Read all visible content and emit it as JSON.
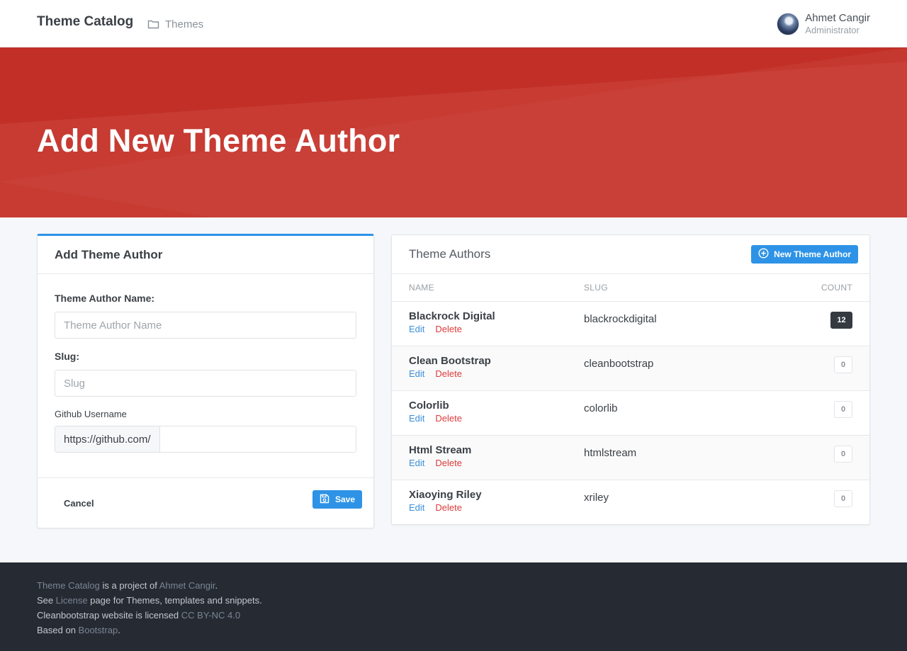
{
  "header": {
    "brand": "Theme Catalog",
    "nav_link": "Themes",
    "nav_icon": "folder-icon",
    "user_name": "Ahmet Cangir",
    "user_role": "Administrator"
  },
  "hero": {
    "title": "Add New Theme Author",
    "color": "#c5342b"
  },
  "form": {
    "title": "Add Theme Author",
    "name_label": "Theme Author Name:",
    "name_placeholder": "Theme Author Name",
    "slug_label": "Slug:",
    "slug_placeholder": "Slug",
    "github_label": "Github Username",
    "github_prefix": "https://github.com/",
    "github_value": "",
    "cancel_label": "Cancel",
    "save_label": "Save",
    "save_icon": "floppy-disk-icon"
  },
  "authors": {
    "title": "Theme Authors",
    "new_button": "New Theme Author",
    "new_icon": "plus-circle-icon",
    "columns": {
      "name": "Name",
      "slug": "Slug",
      "count": "Count"
    },
    "edit_label": "Edit",
    "delete_label": "Delete",
    "rows": [
      {
        "name": "Blackrock Digital",
        "slug": "blackrockdigital",
        "count": "12"
      },
      {
        "name": "Clean Bootstrap",
        "slug": "cleanbootstrap",
        "count": "0"
      },
      {
        "name": "Colorlib",
        "slug": "colorlib",
        "count": "0"
      },
      {
        "name": "Html Stream",
        "slug": "htmlstream",
        "count": "0"
      },
      {
        "name": "Xiaoying Riley",
        "slug": "xriley",
        "count": "0"
      }
    ]
  },
  "footer": {
    "line1_link1": "Theme Catalog",
    "line1_text": " is a project of ",
    "line1_link2": "Ahmet Cangir",
    "line1_end": ".",
    "line2_start": "See ",
    "line2_link": "License",
    "line2_end": " page for Themes, templates and snippets.",
    "line3_start": "Cleanbootstrap website is licensed ",
    "line3_link": "CC BY-NC 4.0",
    "line4_start": "Based on ",
    "line4_link": "Bootstrap",
    "line4_end": "."
  },
  "colors": {
    "accent": "#2e93e6",
    "danger": "#dc3b3b",
    "footer_bg": "#262b33",
    "badge_dark": "#343a40"
  }
}
